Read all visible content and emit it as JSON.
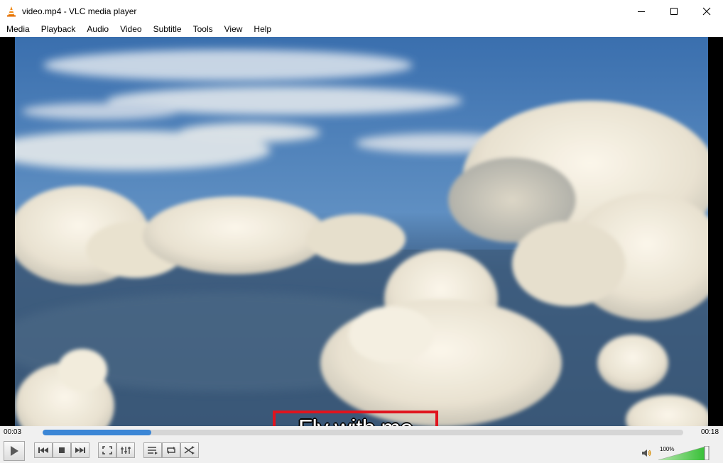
{
  "window": {
    "title": "video.mp4 - VLC media player"
  },
  "menu": {
    "items": [
      "Media",
      "Playback",
      "Audio",
      "Video",
      "Subtitle",
      "Tools",
      "View",
      "Help"
    ]
  },
  "player": {
    "subtitle": "Fly with me",
    "elapsed": "00:03",
    "total": "00:18",
    "progress_fraction": 0.17,
    "volume": "100%",
    "volume_fraction": 1.0
  },
  "controls": {
    "icons": [
      "play-icon",
      "previous-icon",
      "stop-icon",
      "next-icon",
      "fullscreen-icon",
      "extended-settings-icon",
      "playlist-icon",
      "loop-icon",
      "shuffle-icon",
      "speaker-icon"
    ]
  },
  "colors": {
    "accent": "#3b86d6",
    "highlight": "#e0141e",
    "volume_green": "#2ebd2e"
  }
}
